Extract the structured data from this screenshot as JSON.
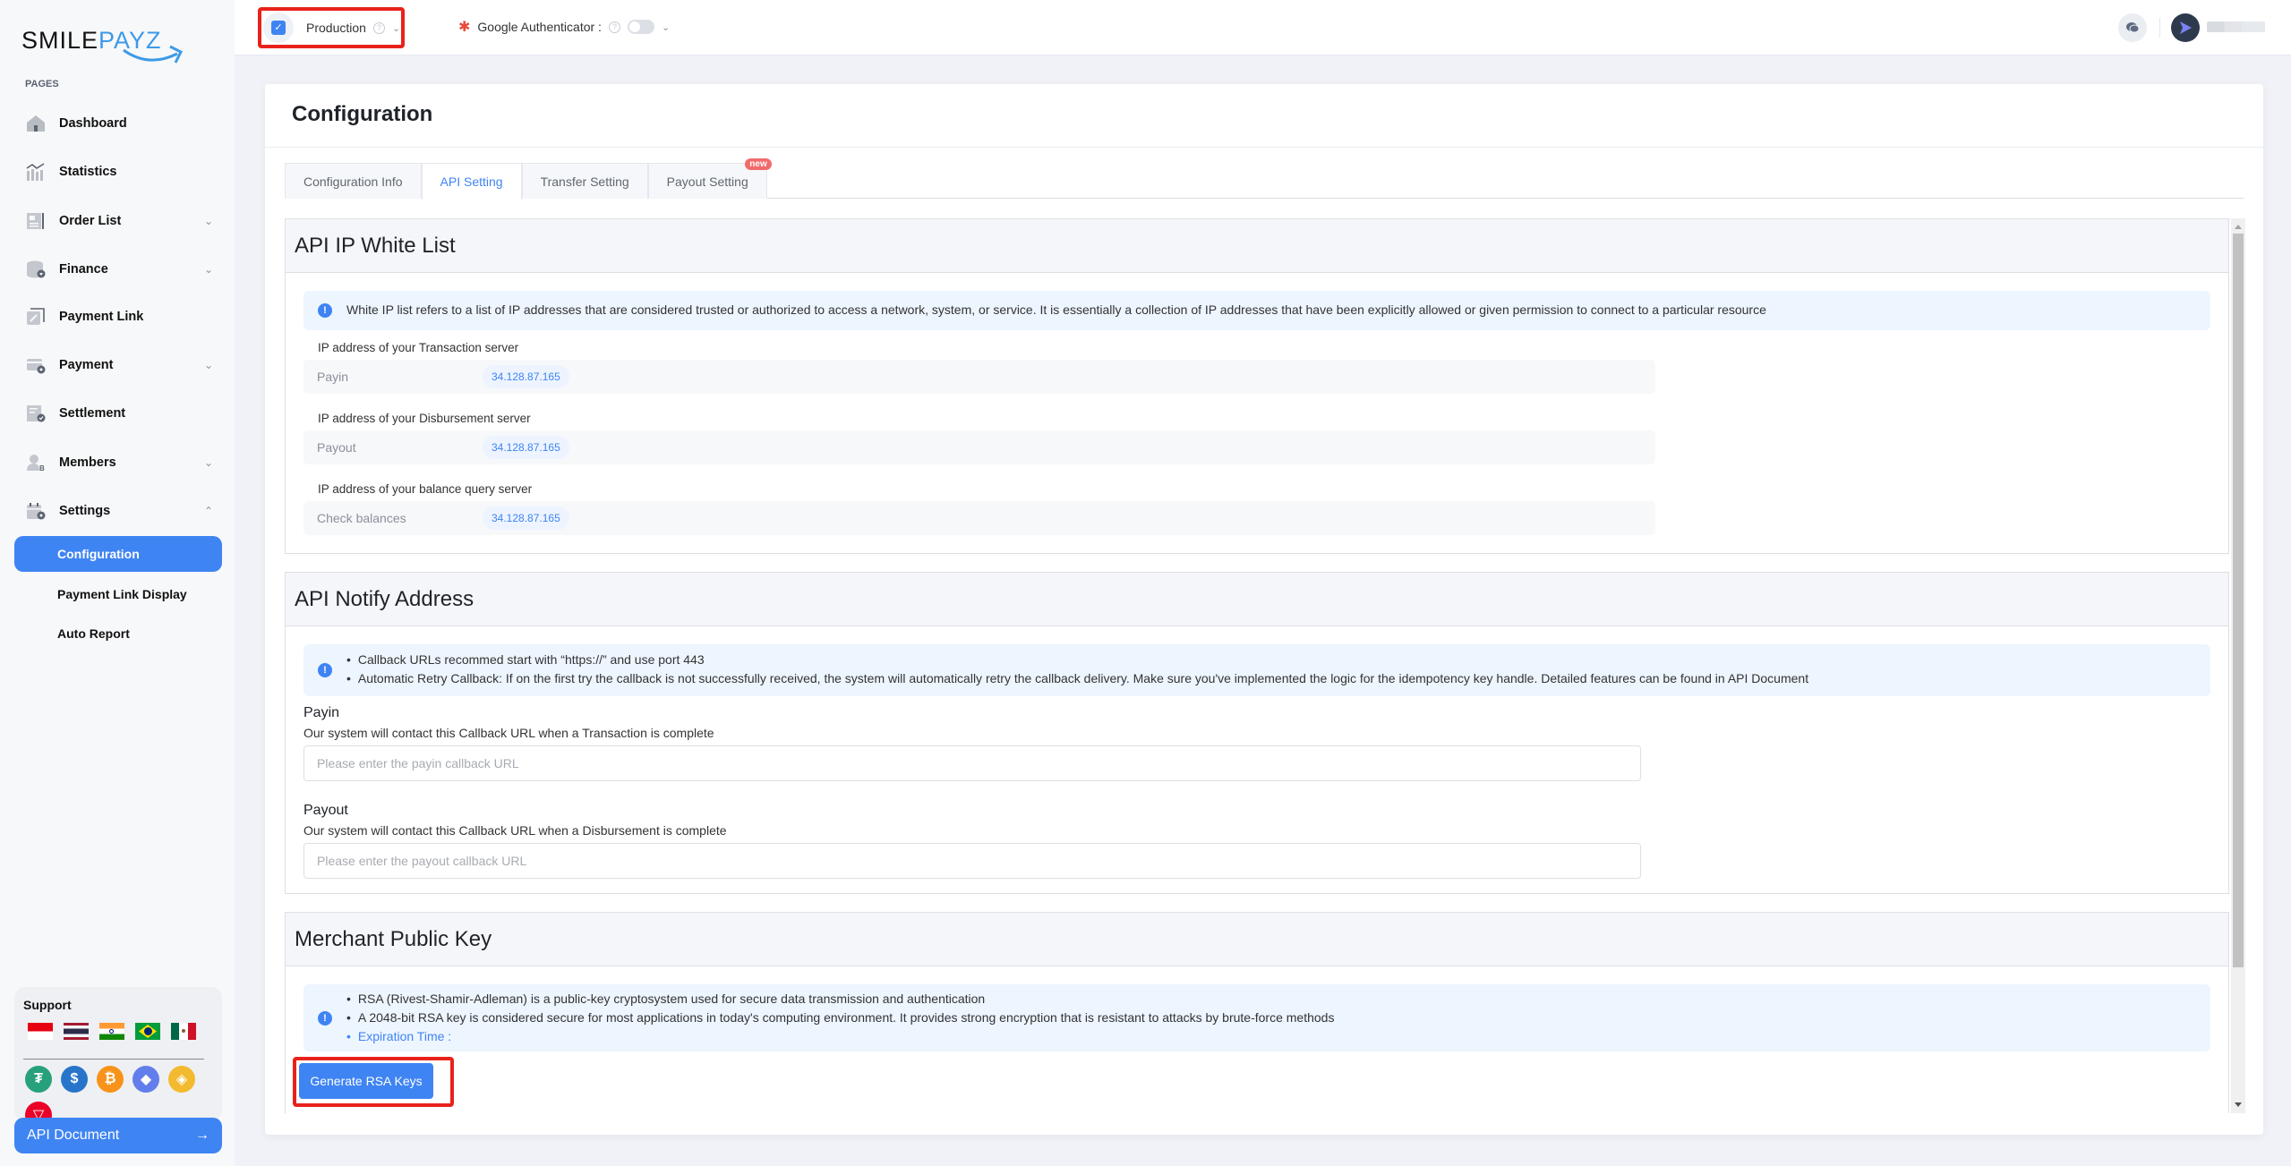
{
  "brand": {
    "name_part1": "SMILE",
    "name_part2": "PAYZ"
  },
  "sidebar": {
    "section_label": "PAGES",
    "items": [
      {
        "label": "Dashboard",
        "icon": "home-icon",
        "has_chevron": false
      },
      {
        "label": "Statistics",
        "icon": "chart-icon",
        "has_chevron": false
      },
      {
        "label": "Order List",
        "icon": "list-icon",
        "has_chevron": true
      },
      {
        "label": "Finance",
        "icon": "database-icon",
        "has_chevron": true
      },
      {
        "label": "Payment Link",
        "icon": "link-icon",
        "has_chevron": false
      },
      {
        "label": "Payment",
        "icon": "card-gear-icon",
        "has_chevron": true
      },
      {
        "label": "Settlement",
        "icon": "receipt-icon",
        "has_chevron": false
      },
      {
        "label": "Members",
        "icon": "user-icon",
        "has_chevron": true
      },
      {
        "label": "Settings",
        "icon": "calendar-gear-icon",
        "has_chevron": true,
        "expanded": true
      }
    ],
    "sub_items": [
      {
        "label": "Configuration",
        "active": true
      },
      {
        "label": "Payment Link Display",
        "active": false
      },
      {
        "label": "Auto Report",
        "active": false
      }
    ],
    "support": {
      "title": "Support",
      "flags": [
        "indonesia-flag",
        "thailand-flag",
        "india-flag",
        "brazil-flag",
        "mexico-flag"
      ],
      "coins": [
        {
          "name": "tether-icon",
          "glyph": "₮",
          "color": "#26a17b"
        },
        {
          "name": "usdc-icon",
          "glyph": "$",
          "color": "#2775ca"
        },
        {
          "name": "bitcoin-icon",
          "glyph": "₿",
          "color": "#f7931a"
        },
        {
          "name": "ethereum-icon",
          "glyph": "◆",
          "color": "#627eea"
        },
        {
          "name": "bnb-icon",
          "glyph": "◈",
          "color": "#f3ba2f"
        },
        {
          "name": "tron-icon",
          "glyph": "▽",
          "color": "#eb0029"
        }
      ]
    },
    "api_document": {
      "label": "API Document",
      "arrow": "→"
    }
  },
  "topbar": {
    "environment": "Production",
    "google_auth_label": "Google Authenticator :",
    "google_auth_enabled": false
  },
  "page": {
    "title": "Configuration",
    "tabs": [
      {
        "label": "Configuration Info",
        "active": false
      },
      {
        "label": "API Setting",
        "active": true
      },
      {
        "label": "Transfer Setting",
        "active": false
      },
      {
        "label": "Payout Setting",
        "active": false,
        "badge": "new"
      }
    ]
  },
  "ip_whitelist": {
    "title": "API IP White List",
    "info": "White IP list refers to a list of IP addresses that are considered trusted or authorized to access a network, system, or service. It is essentially a collection of IP addresses that have been explicitly allowed or given permission to connect to a particular resource",
    "groups": [
      {
        "label": "IP address of your Transaction server",
        "key": "Payin",
        "value": "34.128.87.165"
      },
      {
        "label": "IP address of your Disbursement server",
        "key": "Payout",
        "value": "34.128.87.165"
      },
      {
        "label": "IP address of your balance query server",
        "key": "Check balances",
        "value": "34.128.87.165"
      }
    ]
  },
  "notify": {
    "title": "API Notify Address",
    "bullets": [
      "Callback URLs recommed start with “https://” and use port 443",
      "Automatic Retry Callback: If on the first try the callback is not successfully received, the system will automatically retry the callback delivery. Make sure you've implemented the logic for the idempotency key handle. Detailed features can be found in API Document"
    ],
    "payin": {
      "label": "Payin",
      "desc": "Our system will contact this Callback URL when a Transaction is complete",
      "value": "",
      "placeholder": "Please enter the payin callback URL"
    },
    "payout": {
      "label": "Payout",
      "desc": "Our system will contact this Callback URL when a Disbursement is complete",
      "value": "",
      "placeholder": "Please enter the payout callback URL"
    }
  },
  "public_key": {
    "title": "Merchant Public Key",
    "bullets": [
      "RSA (Rivest-Shamir-Adleman) is a public-key cryptosystem used for secure data transmission and authentication",
      "A 2048-bit RSA key is considered secure for most applications in today's computing environment. It provides strong encryption that is resistant to attacks by brute-force methods"
    ],
    "expiration_label": "Expiration Time :",
    "generate_button": "Generate RSA Keys"
  }
}
